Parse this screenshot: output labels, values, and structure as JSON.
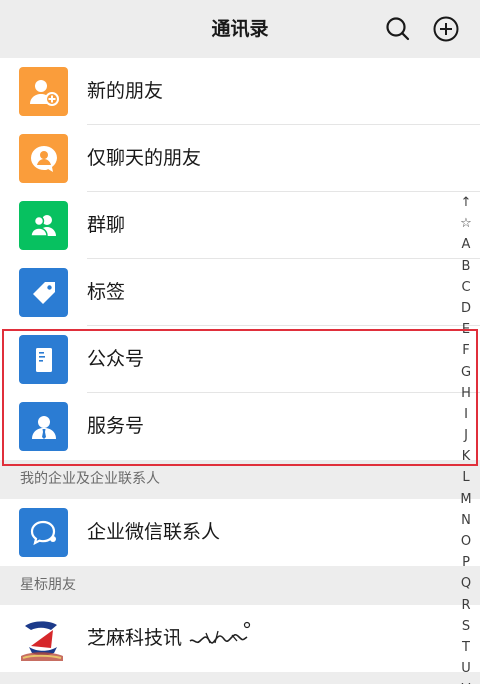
{
  "header": {
    "title": "通讯录",
    "search_icon": "search-icon",
    "add_icon": "add-circle-icon"
  },
  "top_items": [
    {
      "label": "新的朋友",
      "icon": "add-friend-icon",
      "color": "#fa9d3b"
    },
    {
      "label": "仅聊天的朋友",
      "icon": "chat-only-friend-icon",
      "color": "#fa9d3b"
    },
    {
      "label": "群聊",
      "icon": "group-chat-icon",
      "color": "#07c160"
    },
    {
      "label": "标签",
      "icon": "tag-icon",
      "color": "#2b7cd3"
    },
    {
      "label": "公众号",
      "icon": "official-account-icon",
      "color": "#2b7cd3"
    },
    {
      "label": "服务号",
      "icon": "service-account-icon",
      "color": "#2b7cd3"
    }
  ],
  "enterprise_section": {
    "title": "我的企业及企业联系人",
    "item": {
      "label": "企业微信联系人",
      "icon": "wecom-icon",
      "color": "#2b7cd3"
    }
  },
  "starred_section": {
    "title": "星标朋友",
    "item": {
      "label": "芝麻科技讯"
    }
  },
  "index_bar": [
    "↑",
    "☆",
    "A",
    "B",
    "C",
    "D",
    "E",
    "F",
    "G",
    "H",
    "I",
    "J",
    "K",
    "L",
    "M",
    "N",
    "O",
    "P",
    "Q",
    "R",
    "S",
    "T",
    "U",
    "V"
  ],
  "colors": {
    "highlight": "#e02f3b",
    "background": "#ededed"
  }
}
